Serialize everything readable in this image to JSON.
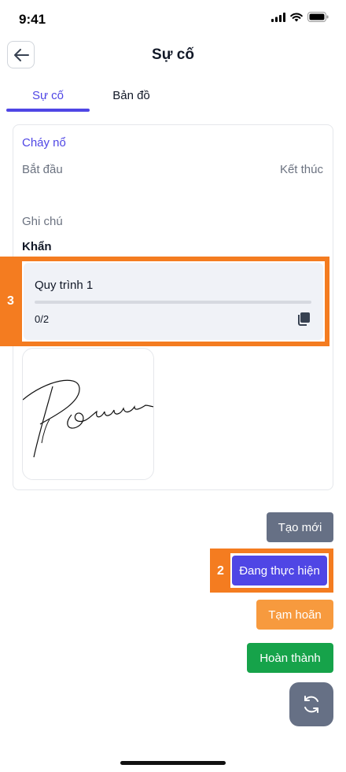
{
  "status_bar": {
    "time": "9:41"
  },
  "header": {
    "title": "Sự cố",
    "back_icon": "arrow-left-icon"
  },
  "tabs": [
    {
      "label": "Sự cố",
      "active": true
    },
    {
      "label": "Bản đồ",
      "active": false
    }
  ],
  "incident": {
    "type": "Cháy nổ",
    "start_label": "Bắt đầu",
    "end_label": "Kết thúc",
    "note_label": "Ghi chú",
    "priority": "Khẩn"
  },
  "process": {
    "name": "Quy trình 1",
    "count": "0/2",
    "progress": 0,
    "copy_icon": "copy-icon"
  },
  "annotations": {
    "marker_3": "3",
    "marker_2": "2"
  },
  "actions": {
    "new_label": "Tạo mới",
    "in_progress_label": "Đang thực hiện",
    "pause_label": "Tạm hoãn",
    "done_label": "Hoàn thành",
    "refresh_icon": "refresh-icon"
  },
  "colors": {
    "accent": "#4f46e5",
    "highlight": "#f47c20",
    "slate_button": "#667085",
    "pause_button": "#f79a3e",
    "done_button": "#16a34a"
  }
}
